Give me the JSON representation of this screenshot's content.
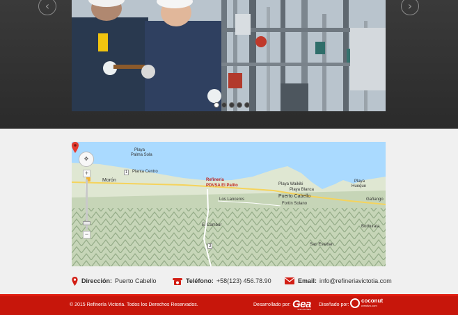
{
  "slider": {
    "prev_icon": "chevron-left-icon",
    "next_icon": "chevron-right-icon",
    "dots": [
      true,
      false,
      false,
      false,
      false
    ]
  },
  "map": {
    "marker_label_1": "Refinería",
    "marker_label_2": "PDVSA El Palito",
    "places": {
      "playa_palma_sola_1": "Playa",
      "playa_palma_sola_2": "Palma Sola",
      "planta_centro": "Planta Centro",
      "moron": "Morón",
      "playa_waikiki": "Playa Waikiki",
      "playa_blanca": "Playa Blanca",
      "puerto_cabello": "Puerto Cabello",
      "fortin_solano": "Fortín Solano",
      "los_lanceros": "Los Lanceros",
      "el_cambur": "El Cambur",
      "playa_hueque_1": "Playa",
      "playa_hueque_2": "Hueque",
      "ganango": "Gañango",
      "borburata": "Borburata",
      "san_esteban": "San Esteban",
      "road_1": "1",
      "road_3": "3"
    }
  },
  "contact": {
    "address_label": "Dirección:",
    "address_value": "Puerto Cabello",
    "phone_label": "Teléfono:",
    "phone_value": "+58(123) 456.78.90",
    "email_label": "Email:",
    "email_value": "info@refineriavictotia.com"
  },
  "footer": {
    "copyright": "© 2015 Refinería Victoria.  Todos los Derechos Reservados.",
    "developed_by": "Desarrollado por:",
    "dev_logo": "Gea",
    "dev_logo_sub": "SOLUCIONES",
    "designed_by": "Diseñado por:",
    "design_logo": "coconut",
    "design_logo_sub": "creativo.com"
  },
  "colors": {
    "footer_bg": "#c7160b",
    "accent_red": "#d21e14",
    "hero_bg": "#333333"
  }
}
